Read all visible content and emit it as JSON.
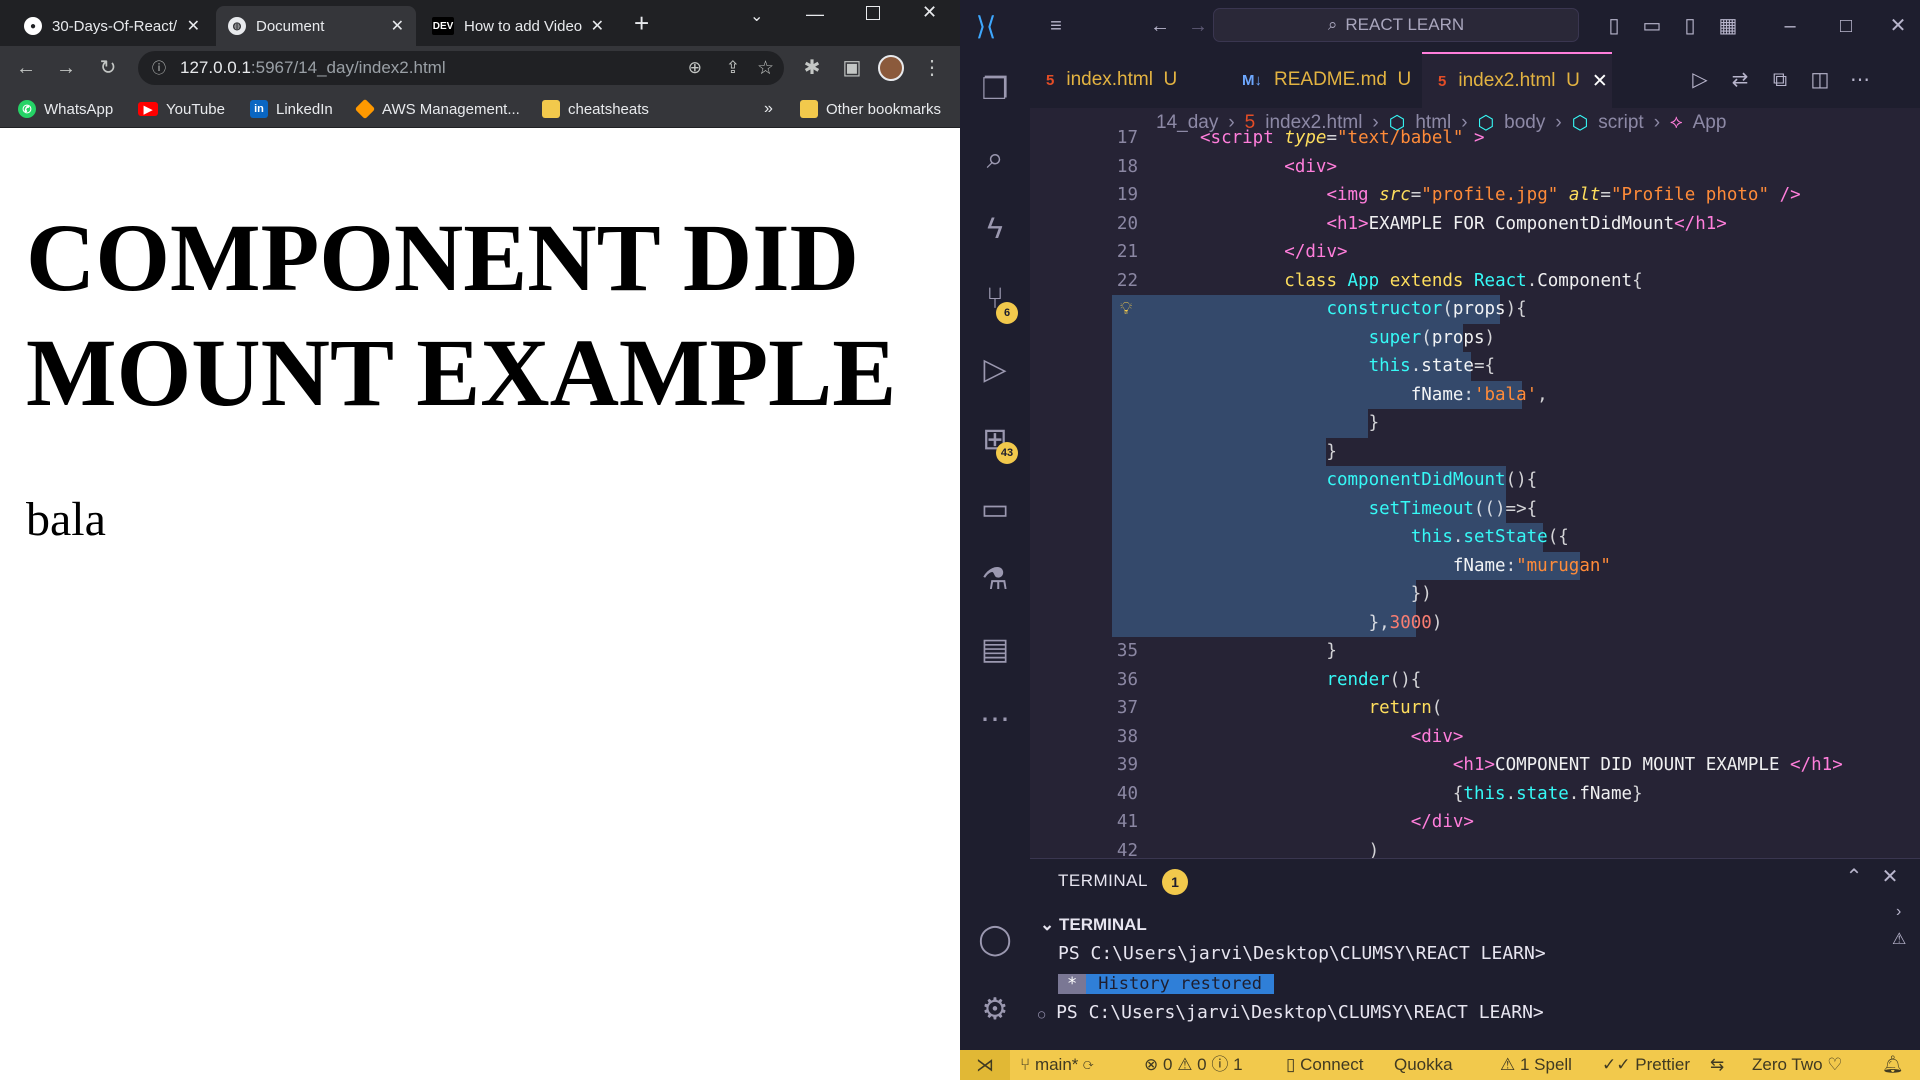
{
  "chrome": {
    "tabs": [
      {
        "title": "30-Days-Of-React/",
        "favicon": "github-icon"
      },
      {
        "title": "Document",
        "favicon": "globe-icon"
      },
      {
        "title": "How to add Video",
        "favicon": "dev-icon",
        "favicon_text": "DEV"
      }
    ],
    "new_tab": "+",
    "url_host": "127.0.0.1",
    "url_path": ":5967/14_day/index2.html",
    "bookmarks": [
      {
        "label": "WhatsApp",
        "icon": "whatsapp-icon",
        "color": "#25d366"
      },
      {
        "label": "YouTube",
        "icon": "youtube-icon",
        "color": "#ff0000"
      },
      {
        "label": "LinkedIn",
        "icon": "linkedin-icon",
        "color": "#0a66c2",
        "icon_text": "in"
      },
      {
        "label": "AWS Management...",
        "icon": "aws-icon",
        "color": "#ff9900"
      },
      {
        "label": "cheatsheats",
        "icon": "folder-icon",
        "color": "#f2c94c"
      }
    ],
    "more_bookmarks": "»",
    "other_bookmarks": "Other bookmarks",
    "page_heading": "COMPONENT DID MOUNT EXAMPLE",
    "page_text": "bala"
  },
  "vscode": {
    "command_center": "REACT LEARN",
    "tabs": [
      {
        "label": "index.html",
        "status": "U",
        "icon": "html5-icon"
      },
      {
        "label": "README.md",
        "status": "U",
        "icon": "markdown-icon"
      },
      {
        "label": "index2.html",
        "status": "U",
        "icon": "html5-icon"
      }
    ],
    "breadcrumb": [
      "14_day",
      "index2.html",
      "html",
      "body",
      "script",
      "App"
    ],
    "activity_badges": {
      "source_control": "6",
      "extensions": "43"
    },
    "lines": [
      {
        "n": "17",
        "html": "<span class=\"pink\">&lt;script</span> <span class=\"attr\">type</span>=<span class=\"str\">\"text/babel\"</span> <span class=\"pink\">&gt;</span>"
      },
      {
        "n": "18",
        "html": "        <span class=\"pink\">&lt;div&gt;</span>"
      },
      {
        "n": "19",
        "html": "            <span class=\"pink\">&lt;img</span> <span class=\"attr\">src</span>=<span class=\"str\">\"profile.jpg\"</span> <span class=\"attr\">alt</span>=<span class=\"str\">\"Profile photo\"</span> <span class=\"pink\">/&gt;</span>"
      },
      {
        "n": "20",
        "html": "            <span class=\"pink\">&lt;h1&gt;</span><span class=\"white\">EXAMPLE FOR ComponentDidMount</span><span class=\"pink\">&lt;/h1&gt;</span>"
      },
      {
        "n": "21",
        "html": "        <span class=\"pink\">&lt;/div&gt;</span>"
      },
      {
        "n": "22",
        "html": "        <span class=\"kw\">class</span> <span class=\"cyan\">App</span> <span class=\"kw\">extends</span> <span class=\"cyan\">React</span>.<span class=\"white\">Component</span>{"
      },
      {
        "n": "23",
        "html": "            <span class=\"cyan\">constructor</span>(<span class=\"white\">props</span>){",
        "sel": [
          170,
          300
        ],
        "current": true
      },
      {
        "n": "24",
        "html": "                <span class=\"cyan\">super</span>(<span class=\"white\">props</span>)",
        "sel": [
          170,
          263
        ]
      },
      {
        "n": "25",
        "html": "                <span class=\"cyan\">this</span>.<span class=\"white\">state</span>={",
        "sel": [
          170,
          271
        ]
      },
      {
        "n": "26",
        "html": "                    <span class=\"white\">fName</span>:<span class=\"str\">'bala'</span>,",
        "sel": [
          170,
          322
        ]
      },
      {
        "n": "27",
        "html": "                }",
        "sel": [
          170,
          168
        ]
      },
      {
        "n": "28",
        "html": "            }",
        "sel": [
          170,
          126
        ]
      },
      {
        "n": "29",
        "html": "            <span class=\"cyan\">componentDidMount</span>(){",
        "sel": [
          170,
          306
        ]
      },
      {
        "n": "30",
        "html": "                <span class=\"cyan\">setTimeout</span>((<span class=\"white\"></span>)=&gt;{",
        "sel": [
          170,
          306
        ]
      },
      {
        "n": "31",
        "html": "                    <span class=\"cyan\">this</span>.<span class=\"cyan\">setState</span>({",
        "sel": [
          170,
          343
        ]
      },
      {
        "n": "32",
        "html": "                        <span class=\"white\">fName</span>:<span class=\"str\">\"murugan\"</span>",
        "sel": [
          170,
          380
        ]
      },
      {
        "n": "33",
        "html": "                    })",
        "sel": [
          170,
          216
        ]
      },
      {
        "n": "34",
        "html": "                },<span class=\"num\">3000</span>)",
        "sel": [
          170,
          216
        ]
      },
      {
        "n": "35",
        "html": "            }"
      },
      {
        "n": "36",
        "html": "            <span class=\"cyan\">render</span>(){"
      },
      {
        "n": "37",
        "html": "                <span class=\"kw\">return</span>("
      },
      {
        "n": "38",
        "html": "                    <span class=\"pink\">&lt;div&gt;</span>"
      },
      {
        "n": "39",
        "html": "                        <span class=\"pink\">&lt;h1&gt;</span><span class=\"white\">COMPONENT DID MOUNT EXAMPLE </span><span class=\"pink\">&lt;/h1&gt;</span>"
      },
      {
        "n": "40",
        "html": "                        {<span class=\"cyan\">this</span>.<span class=\"cyan\">state</span>.<span class=\"white\">fName</span>}"
      },
      {
        "n": "41",
        "html": "                    <span class=\"pink\">&lt;/div&gt;</span>"
      },
      {
        "n": "42",
        "html": "                )"
      }
    ],
    "panel": {
      "tab": "TERMINAL",
      "badge": "1",
      "section": "TERMINAL",
      "prompt1": "PS C:\\Users\\jarvi\\Desktop\\CLUMSY\\REACT LEARN>",
      "history_star": "*",
      "history_msg": "History restored",
      "prompt2": "PS C:\\Users\\jarvi\\Desktop\\CLUMSY\\REACT LEARN>"
    },
    "status": {
      "branch": "main*",
      "errors": "0",
      "warnings": "0",
      "info": "1",
      "connect": "Connect",
      "quokka": "Quokka",
      "spell": "1 Spell",
      "prettier": "Prettier",
      "theme": "Zero Two"
    }
  }
}
